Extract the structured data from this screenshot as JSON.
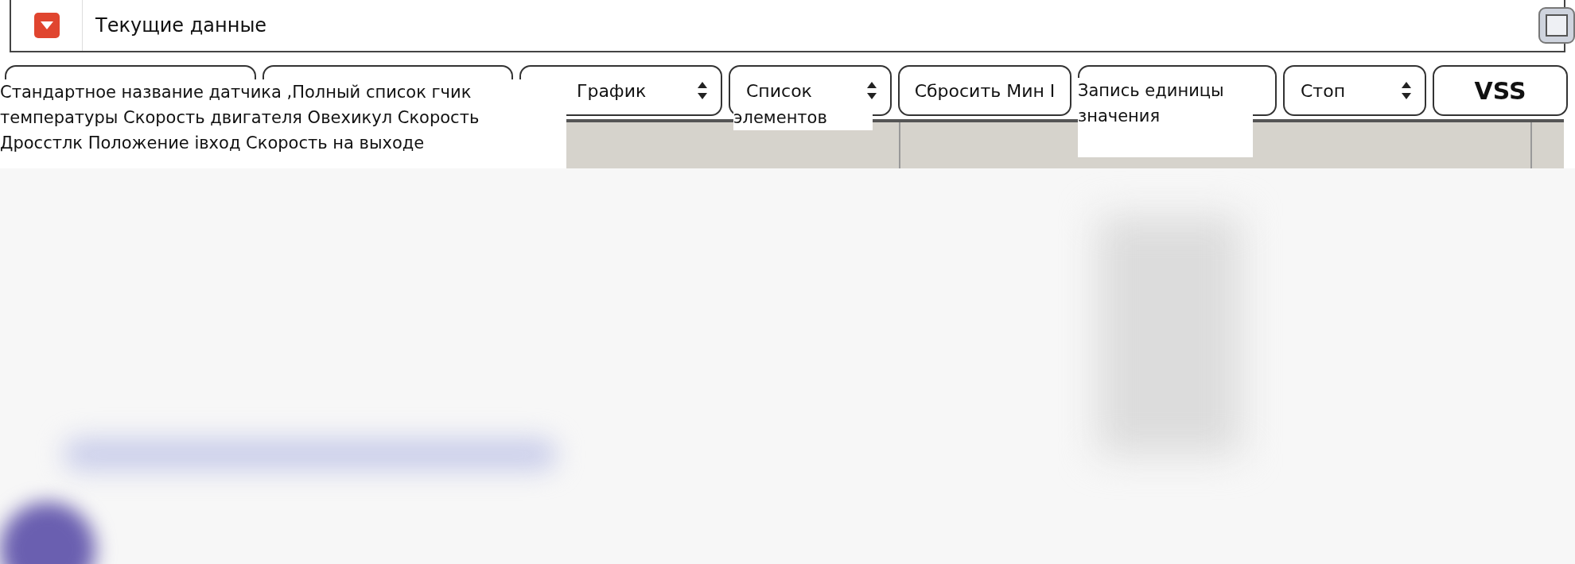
{
  "header": {
    "title": "Текущие данные"
  },
  "toolbar": [
    {
      "kind": "button"
    },
    {
      "kind": "button"
    },
    {
      "kind": "select",
      "label": "График"
    },
    {
      "kind": "select",
      "label": "Список"
    },
    {
      "kind": "button",
      "label": "Сбросить Мин I"
    },
    {
      "kind": "button"
    },
    {
      "kind": "select",
      "label": "Стоп"
    },
    {
      "kind": "button",
      "label": "VSS",
      "bold": true
    }
  ],
  "overlays": [
    {
      "lines": [
        "Стандартное название датчика ,Полный список гчик",
        "температуры Скорость двигателя Овехикул Скорость",
        "Дросстлк Положение івход Скорость на выходе"
      ]
    },
    {
      "lines": [
        "элементов"
      ]
    },
    {
      "lines": [
        "Запись единицы",
        "значения"
      ]
    }
  ]
}
